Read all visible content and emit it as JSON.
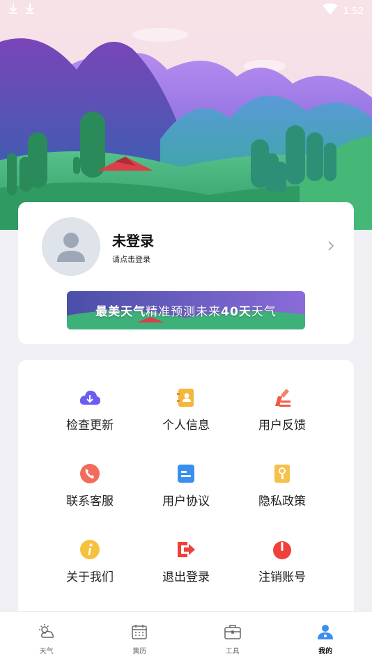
{
  "status_bar": {
    "time": "1:52",
    "icons": [
      "download-icon",
      "download-icon",
      "wifi-icon",
      "battery-icon"
    ]
  },
  "profile": {
    "title": "未登录",
    "subtitle": "请点击登录"
  },
  "banner": {
    "part1": "最美天气",
    "part2": "精准预测未来",
    "part3": "40天",
    "part4": "天气"
  },
  "menu": {
    "items": [
      {
        "label": "检查更新",
        "icon": "cloud-download-icon",
        "color": "#6a5ef0"
      },
      {
        "label": "个人信息",
        "icon": "contact-card-icon",
        "color": "#f4b63c"
      },
      {
        "label": "用户反馈",
        "icon": "edit-feedback-icon",
        "color": "#f05a4a"
      },
      {
        "label": "联系客服",
        "icon": "phone-icon",
        "color": "#f26b5b"
      },
      {
        "label": "用户协议",
        "icon": "agreement-icon",
        "color": "#3a8ef0"
      },
      {
        "label": "隐私政策",
        "icon": "key-icon",
        "color": "#f6c04a"
      },
      {
        "label": "关于我们",
        "icon": "info-icon",
        "color": "#f6c23e"
      },
      {
        "label": "退出登录",
        "icon": "logout-icon",
        "color": "#f0403a"
      },
      {
        "label": "注销账号",
        "icon": "power-icon",
        "color": "#f0403a"
      }
    ]
  },
  "tabs": [
    {
      "label": "天气",
      "icon": "weather-icon"
    },
    {
      "label": "黄历",
      "icon": "calendar-icon"
    },
    {
      "label": "工具",
      "icon": "toolbox-icon"
    },
    {
      "label": "我的",
      "icon": "user-icon",
      "active": true
    }
  ],
  "colors": {
    "accent": "#3a8ef0",
    "background": "#f0eff4"
  }
}
